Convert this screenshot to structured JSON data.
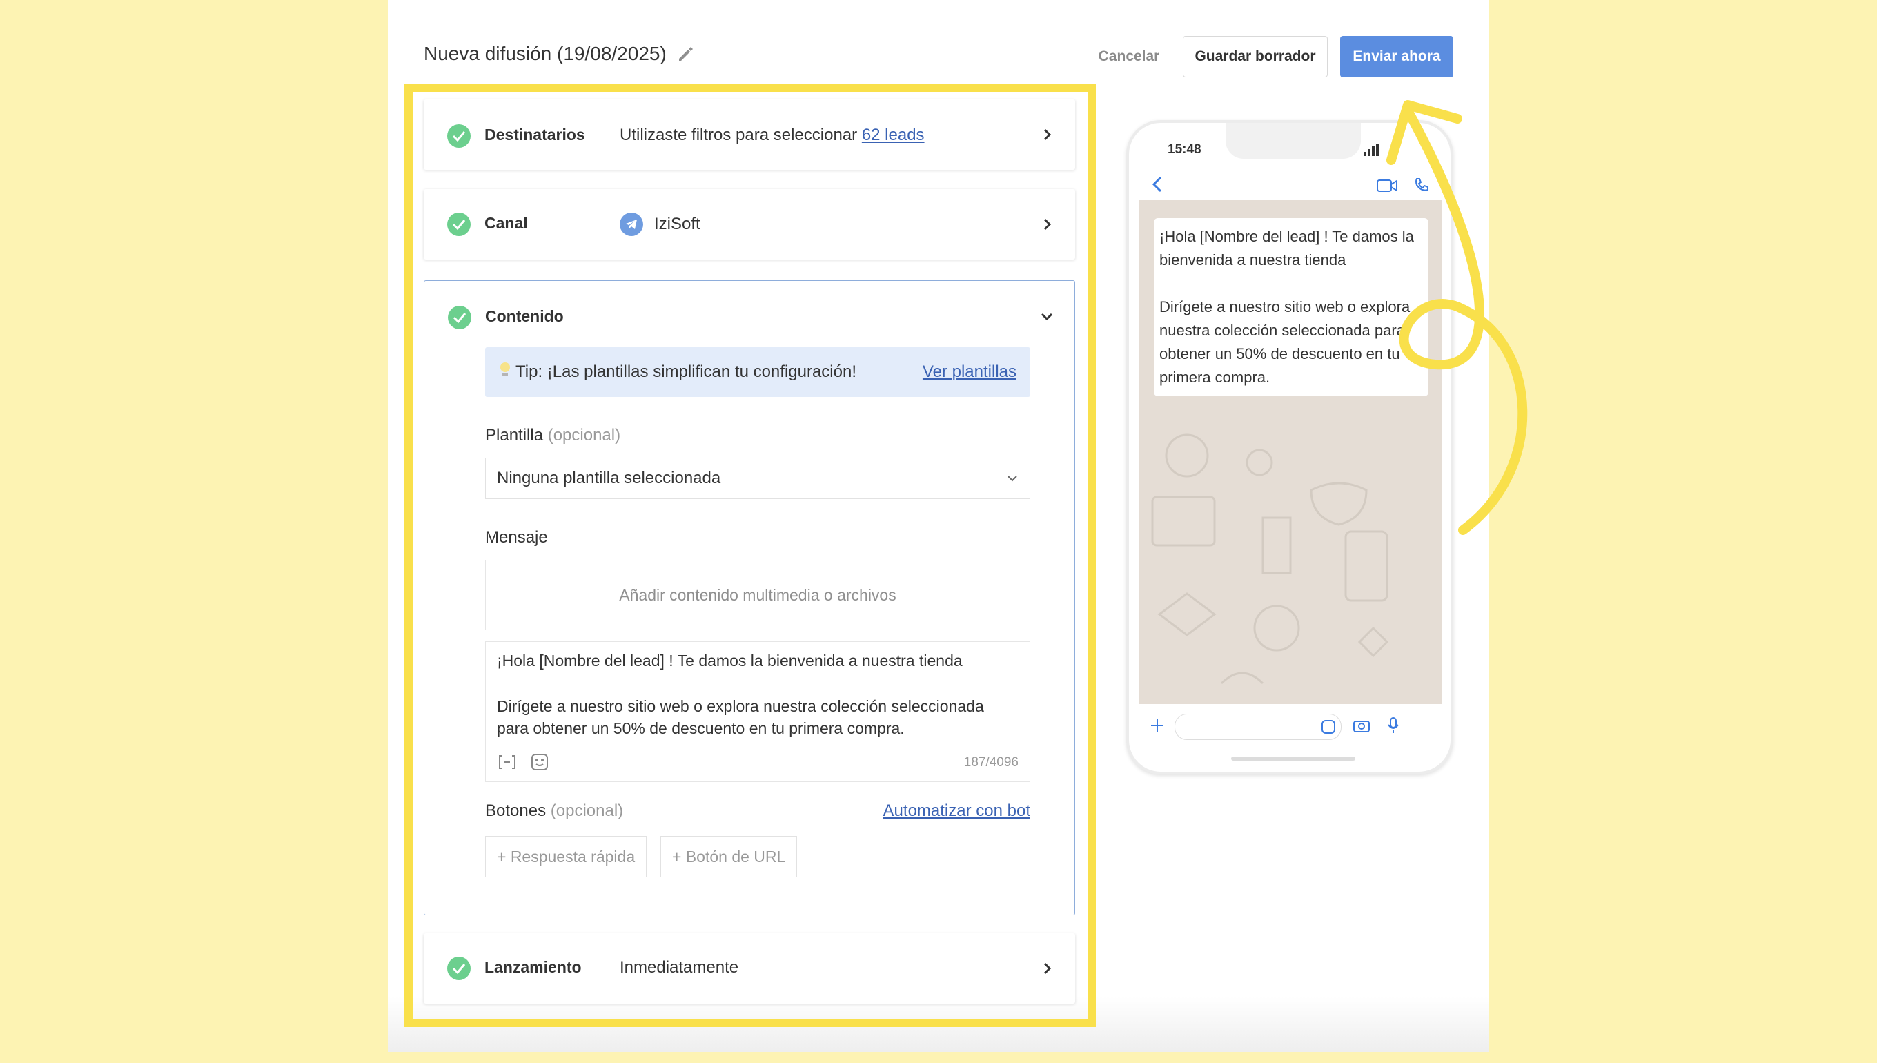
{
  "header": {
    "title": "Nueva difusión (19/08/2025)",
    "cancel_label": "Cancelar",
    "draft_label": "Guardar borrador",
    "send_label": "Enviar ahora"
  },
  "sections": {
    "recipients": {
      "label": "Destinatarios",
      "text": "Utilizaste filtros para seleccionar ",
      "link": "62 leads"
    },
    "channel": {
      "label": "Canal",
      "value": "IziSoft"
    },
    "content": {
      "label": "Contenido",
      "tip_text": "Tip: ¡Las plantillas simplifican tu configuración!",
      "tip_link": "Ver plantillas",
      "template_label": "Plantilla",
      "template_optional": "(opcional)",
      "template_value": "Ninguna plantilla seleccionada",
      "message_label": "Mensaje",
      "media_placeholder": "Añadir contenido multimedia o archivos",
      "message_line1": "¡Hola [Nombre del lead] ! Te damos la bienvenida a nuestra tienda",
      "message_line2": "Dirígete a nuestro sitio web o explora nuestra colección seleccionada",
      "message_line3": "para obtener un 50% de descuento en tu primera compra.",
      "char_count": "187/4096",
      "buttons_label": "Botones",
      "buttons_optional": "(opcional)",
      "automate_link": "Automatizar con bot",
      "quick_reply": "+ Respuesta rápida",
      "url_button": "+ Botón de URL"
    },
    "launch": {
      "label": "Lanzamiento",
      "value": "Inmediatamente"
    }
  },
  "preview": {
    "time": "15:48",
    "bubble_p1": "¡Hola [Nombre del lead] ! Te damos la bienvenida a nuestra tienda",
    "bubble_p2": "Dirígete a nuestro sitio web o explora nuestra colección seleccionada para obtener un 50% de descuento en tu primera compra."
  },
  "colors": {
    "background": "#fdf3b3",
    "highlight": "#f9e04b",
    "primary_button": "#5b8de0",
    "check": "#6ccf8e",
    "tip_background": "#e3ecfa",
    "chat_background": "#e5ddd5"
  }
}
